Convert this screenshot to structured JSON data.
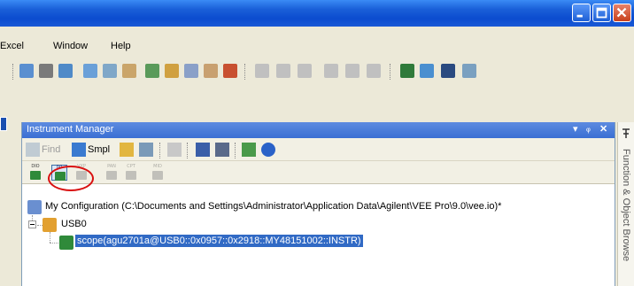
{
  "menu": {
    "items": [
      {
        "label": "Excel",
        "underline_index": 0
      },
      {
        "label": "Window",
        "underline_index": 0
      },
      {
        "label": "Help",
        "underline_index": 0
      }
    ]
  },
  "panel": {
    "title": "Instrument Manager",
    "title_controls": [
      "▾",
      "ᵩ",
      "✕"
    ],
    "toolbar": {
      "find_label": "Find",
      "smpl_label": "Smpl"
    },
    "driver_buttons": [
      {
        "label": "DIO",
        "enabled": true
      },
      {
        "label": "IVI",
        "enabled": true
      },
      {
        "label": "VXP",
        "enabled": false
      },
      {
        "label": "PAN",
        "enabled": false
      },
      {
        "label": "CPT",
        "enabled": false
      },
      {
        "label": "MID",
        "enabled": false
      }
    ]
  },
  "tree": {
    "root_label": "My Configuration (C:\\Documents and Settings\\Administrator\\Application Data\\Agilent\\VEE Pro\\9.0\\vee.io)*",
    "interface_label": "USB0",
    "instrument_label": "scope(agu2701a@USB0::0x0957::0x2918::MY48151002::INSTR)"
  },
  "side_panel": {
    "label": "Function & Object Browse"
  },
  "colors": {
    "title_blue": "#0b4ccf",
    "selection": "#316ac5",
    "highlight_circle": "#d91010"
  }
}
